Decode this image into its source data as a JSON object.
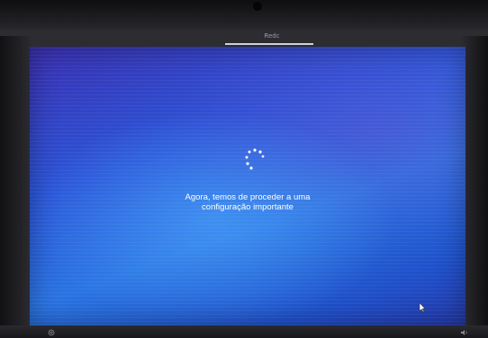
{
  "header": {
    "tab_label": "Redc"
  },
  "status": {
    "line1": "Agora, temos de proceder a uma",
    "line2": "configuração importante"
  },
  "icons": {
    "spinner": "loading-spinner-icon",
    "ease_of_access": "ease-of-access-icon",
    "volume": "volume-icon",
    "cursor": "mouse-cursor-icon"
  },
  "colors": {
    "screen_blue": "#2a74e2",
    "screen_violet": "#3a2fb0",
    "text": "#ffffff"
  }
}
